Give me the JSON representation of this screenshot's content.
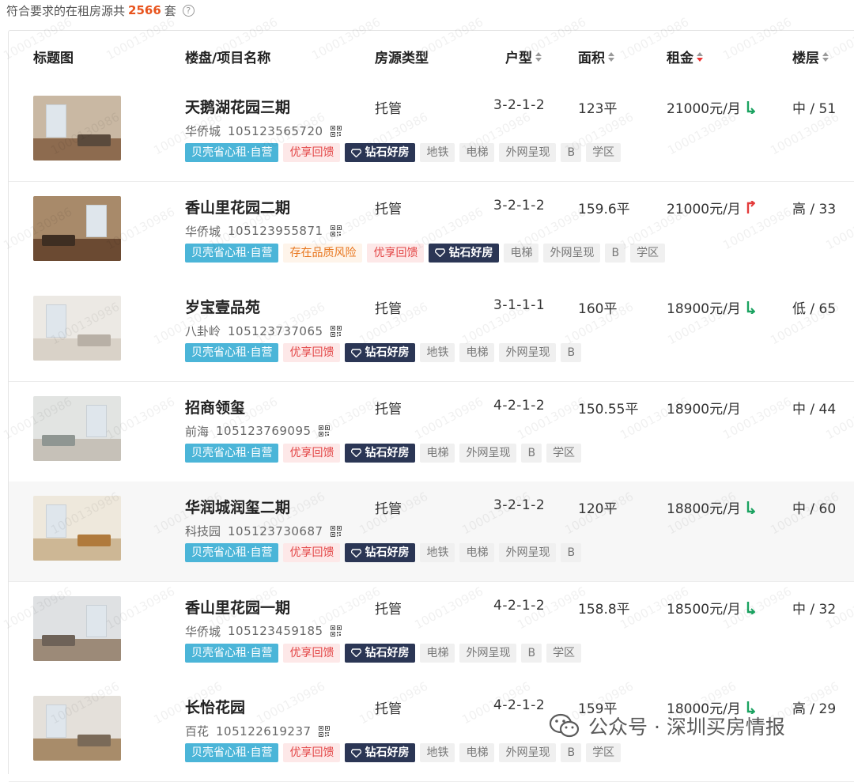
{
  "summary": {
    "prefix": "符合要求的在租房源共",
    "count": "2566",
    "suffix": "套"
  },
  "header": {
    "cols": [
      {
        "label": "标题图",
        "sortable": false
      },
      {
        "label": "楼盘/项目名称",
        "sortable": false
      },
      {
        "label": "房源类型",
        "sortable": false
      },
      {
        "label": "户型",
        "sortable": true,
        "active": false
      },
      {
        "label": "面积",
        "sortable": true,
        "active": false
      },
      {
        "label": "租金",
        "sortable": true,
        "active": true
      },
      {
        "label": "楼层",
        "sortable": true,
        "active": false
      }
    ]
  },
  "listings": [
    {
      "name": "天鹅湖花园三期",
      "district": "华侨城",
      "code": "105123565720",
      "tags": [
        {
          "text": "贝壳省心租·自营",
          "style": "blue"
        },
        {
          "text": "优享回馈",
          "style": "pink"
        },
        {
          "text": "钻石好房",
          "style": "dark"
        },
        {
          "text": "地铁",
          "style": "grey"
        },
        {
          "text": "电梯",
          "style": "grey"
        },
        {
          "text": "外网呈现",
          "style": "grey"
        },
        {
          "text": "B",
          "style": "grey"
        },
        {
          "text": "学区",
          "style": "grey"
        }
      ],
      "type": "托管",
      "layout": "3-2-1-2",
      "area": "123平",
      "rent": "21000元/月",
      "trend": "down",
      "floor": "中 / 51",
      "palette": {
        "wall": "#c9b8a3",
        "floor": "#8d6b4f",
        "furn": "#5a4a3c"
      }
    },
    {
      "name": "香山里花园二期",
      "district": "华侨城",
      "code": "105123955871",
      "tags": [
        {
          "text": "贝壳省心租·自营",
          "style": "blue"
        },
        {
          "text": "存在品质风险",
          "style": "orange"
        },
        {
          "text": "优享回馈",
          "style": "pink"
        },
        {
          "text": "钻石好房",
          "style": "dark"
        },
        {
          "text": "电梯",
          "style": "grey"
        },
        {
          "text": "外网呈现",
          "style": "grey"
        },
        {
          "text": "B",
          "style": "grey"
        },
        {
          "text": "学区",
          "style": "grey"
        }
      ],
      "type": "托管",
      "layout": "3-2-1-2",
      "area": "159.6平",
      "rent": "21000元/月",
      "trend": "up",
      "floor": "高 / 33",
      "palette": {
        "wall": "#a88a6a",
        "floor": "#6b4a32",
        "furn": "#3e2e22"
      }
    },
    {
      "name": "岁宝壹品苑",
      "district": "八卦岭",
      "code": "105123737065",
      "tags": [
        {
          "text": "贝壳省心租·自营",
          "style": "blue"
        },
        {
          "text": "优享回馈",
          "style": "pink"
        },
        {
          "text": "钻石好房",
          "style": "dark"
        },
        {
          "text": "地铁",
          "style": "grey"
        },
        {
          "text": "电梯",
          "style": "grey"
        },
        {
          "text": "外网呈现",
          "style": "grey"
        },
        {
          "text": "B",
          "style": "grey"
        }
      ],
      "type": "托管",
      "layout": "3-1-1-1",
      "area": "160平",
      "rent": "18900元/月",
      "trend": "down",
      "floor": "低 / 65",
      "palette": {
        "wall": "#ece9e4",
        "floor": "#d9d2c8",
        "furn": "#b8b0a6"
      }
    },
    {
      "name": "招商领玺",
      "district": "前海",
      "code": "105123769095",
      "tags": [
        {
          "text": "贝壳省心租·自营",
          "style": "blue"
        },
        {
          "text": "优享回馈",
          "style": "pink"
        },
        {
          "text": "钻石好房",
          "style": "dark"
        },
        {
          "text": "电梯",
          "style": "grey"
        },
        {
          "text": "外网呈现",
          "style": "grey"
        },
        {
          "text": "B",
          "style": "grey"
        },
        {
          "text": "学区",
          "style": "grey"
        }
      ],
      "type": "托管",
      "layout": "4-2-1-2",
      "area": "150.55平",
      "rent": "18900元/月",
      "trend": "none",
      "floor": "中 / 44",
      "palette": {
        "wall": "#e2e4e2",
        "floor": "#c6c1b8",
        "furn": "#8f9692"
      }
    },
    {
      "name": "华润城润玺二期",
      "district": "科技园",
      "code": "105123730687",
      "tags": [
        {
          "text": "贝壳省心租·自营",
          "style": "blue"
        },
        {
          "text": "优享回馈",
          "style": "pink"
        },
        {
          "text": "钻石好房",
          "style": "dark"
        },
        {
          "text": "地铁",
          "style": "grey"
        },
        {
          "text": "电梯",
          "style": "grey"
        },
        {
          "text": "外网呈现",
          "style": "grey"
        },
        {
          "text": "B",
          "style": "grey"
        }
      ],
      "type": "托管",
      "layout": "3-2-1-2",
      "area": "120平",
      "rent": "18800元/月",
      "trend": "down",
      "floor": "中 / 60",
      "palette": {
        "wall": "#eee8dc",
        "floor": "#cdb795",
        "furn": "#b07a3c"
      }
    },
    {
      "name": "香山里花园一期",
      "district": "华侨城",
      "code": "105123459185",
      "tags": [
        {
          "text": "贝壳省心租·自营",
          "style": "blue"
        },
        {
          "text": "优享回馈",
          "style": "pink"
        },
        {
          "text": "钻石好房",
          "style": "dark"
        },
        {
          "text": "电梯",
          "style": "grey"
        },
        {
          "text": "外网呈现",
          "style": "grey"
        },
        {
          "text": "B",
          "style": "grey"
        },
        {
          "text": "学区",
          "style": "grey"
        }
      ],
      "type": "托管",
      "layout": "4-2-1-2",
      "area": "158.8平",
      "rent": "18500元/月",
      "trend": "down",
      "floor": "中 / 32",
      "palette": {
        "wall": "#dfe1e3",
        "floor": "#9c8a78",
        "furn": "#6e6258"
      }
    },
    {
      "name": "长怡花园",
      "district": "百花",
      "code": "105122619237",
      "tags": [
        {
          "text": "贝壳省心租·自营",
          "style": "blue"
        },
        {
          "text": "优享回馈",
          "style": "pink"
        },
        {
          "text": "钻石好房",
          "style": "dark"
        },
        {
          "text": "地铁",
          "style": "grey"
        },
        {
          "text": "电梯",
          "style": "grey"
        },
        {
          "text": "外网呈现",
          "style": "grey"
        },
        {
          "text": "B",
          "style": "grey"
        },
        {
          "text": "学区",
          "style": "grey"
        }
      ],
      "type": "托管",
      "layout": "4-2-1-2",
      "area": "159平",
      "rent": "18000元/月",
      "trend": "down",
      "floor": "高 / 29",
      "palette": {
        "wall": "#e4e0da",
        "floor": "#a88c6a",
        "furn": "#7a6a58"
      }
    }
  ],
  "watermark": "1000130986",
  "footer": {
    "text": "公众号 · 深圳买房情报"
  },
  "colors": {
    "accent": "#e8541e",
    "trend_down": "#1aa260",
    "trend_up": "#e33a3a",
    "tag_blue": "#4bb5d8",
    "tag_dark": "#2b3655"
  }
}
